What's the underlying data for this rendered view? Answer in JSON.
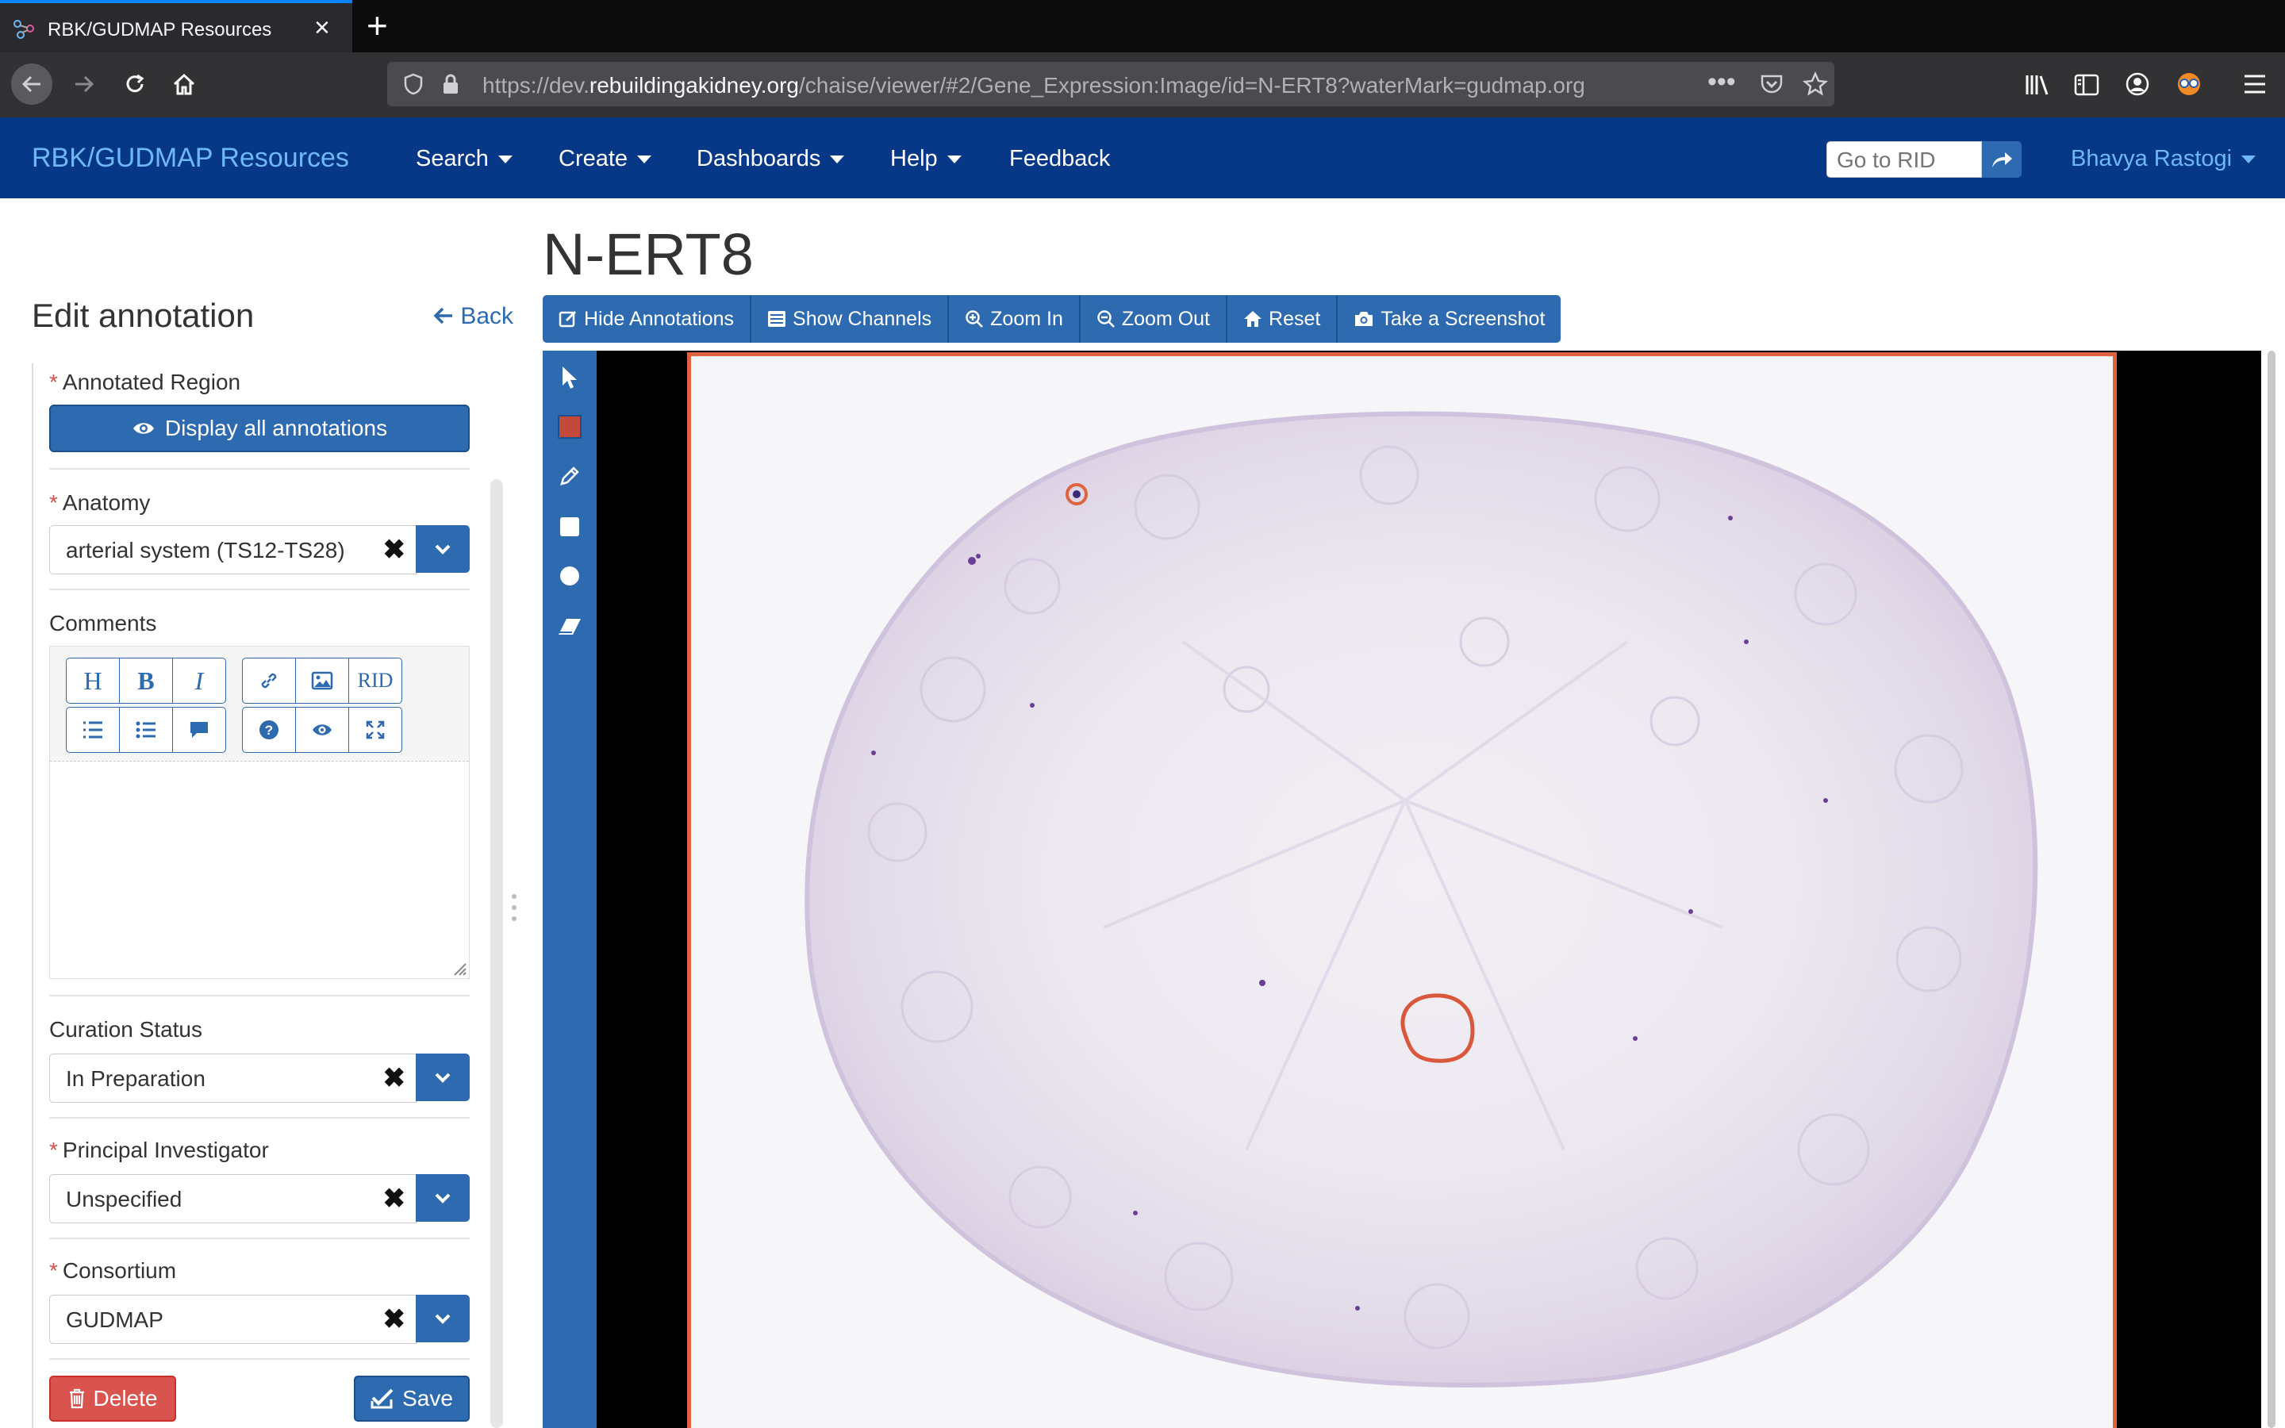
{
  "browser": {
    "tab_title": "RBK/GUDMAP Resources",
    "url_prefix": "https://dev.",
    "url_domain": "rebuildingakidney.org",
    "url_path": "/chaise/viewer/#2/Gene_Expression:Image/id=N-ERT8?waterMark=gudmap.org"
  },
  "nav": {
    "brand": "RBK/GUDMAP Resources",
    "menus": [
      "Search",
      "Create",
      "Dashboards",
      "Help"
    ],
    "feedback": "Feedback",
    "rid_placeholder": "Go to RID",
    "user": "Bhavya Rastogi"
  },
  "panel": {
    "title": "Edit annotation",
    "back": "Back",
    "annotated_region_label": "Annotated Region",
    "display_all": "Display all annotations",
    "anatomy_label": "Anatomy",
    "anatomy_value": "arterial system (TS12-TS28)",
    "comments_label": "Comments",
    "toolbar": {
      "heading": "H",
      "bold": "B",
      "italic": "I",
      "rid": "RID"
    },
    "curation_label": "Curation Status",
    "curation_value": "In Preparation",
    "pi_label": "Principal Investigator",
    "pi_value": "Unspecified",
    "consortium_label": "Consortium",
    "consortium_value": "GUDMAP",
    "delete": "Delete",
    "save": "Save"
  },
  "viewer": {
    "title": "N-ERT8",
    "tools": [
      "Hide Annotations",
      "Show Channels",
      "Zoom In",
      "Zoom Out",
      "Reset",
      "Take a Screenshot"
    ],
    "draw_tools": [
      "pointer-icon",
      "color-swatch-icon",
      "pencil-icon",
      "rectangle-icon",
      "circle-icon",
      "eraser-icon"
    ]
  },
  "colors": {
    "navbar": "#063887",
    "primary": "#2e6ab0",
    "danger": "#d9534f",
    "annotation": "#e0633f"
  }
}
